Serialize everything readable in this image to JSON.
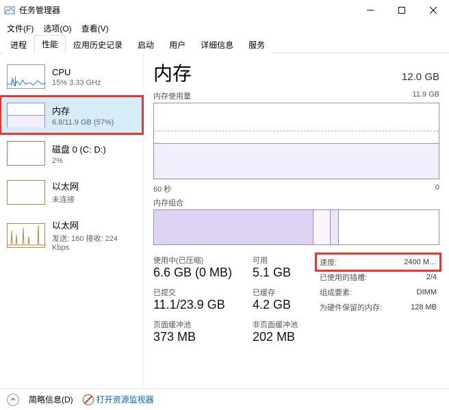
{
  "window": {
    "title": "任务管理器"
  },
  "menu": {
    "file": "文件(F)",
    "options": "选项(O)",
    "view": "查看(V)"
  },
  "tabs": [
    "进程",
    "性能",
    "应用历史记录",
    "启动",
    "用户",
    "详细信息",
    "服务"
  ],
  "active_tab": 1,
  "sidebar": {
    "items": [
      {
        "title": "CPU",
        "sub": "15% 3.33 GHz"
      },
      {
        "title": "内存",
        "sub": "6.8/11.9 GB (57%)"
      },
      {
        "title": "磁盘 0 (C: D:)",
        "sub": "2%"
      },
      {
        "title": "以太网",
        "sub": "未连接"
      },
      {
        "title": "以太网",
        "sub": "发送: 160 接收: 224 Kbps"
      }
    ]
  },
  "main": {
    "title": "内存",
    "total": "12.0 GB",
    "usage_label": "内存使用量",
    "usage_max": "11.9 GB",
    "xaxis_left": "60 秒",
    "xaxis_right": "0",
    "comp_label": "内存组合",
    "stats": {
      "in_use_label": "使用中(已压缩)",
      "in_use": "6.6 GB (0 MB)",
      "avail_label": "可用",
      "avail": "5.1 GB",
      "committed_label": "已提交",
      "committed": "11.1/23.9 GB",
      "cached_label": "已缓存",
      "cached": "4.2 GB",
      "paged_label": "页面缓冲池",
      "paged": "373 MB",
      "nonpaged_label": "非页面缓冲池",
      "nonpaged": "202 MB"
    },
    "right": {
      "speed_label": "速度:",
      "speed": "2400 M…",
      "slots_label": "已使用的插槽:",
      "slots": "2/4",
      "form_label": "组成要素:",
      "form": "DIMM",
      "reserved_label": "为硬件保留的内存:",
      "reserved": "128 MB"
    }
  },
  "footer": {
    "fewer": "简略信息(D)",
    "resmon": "打开资源监视器"
  }
}
